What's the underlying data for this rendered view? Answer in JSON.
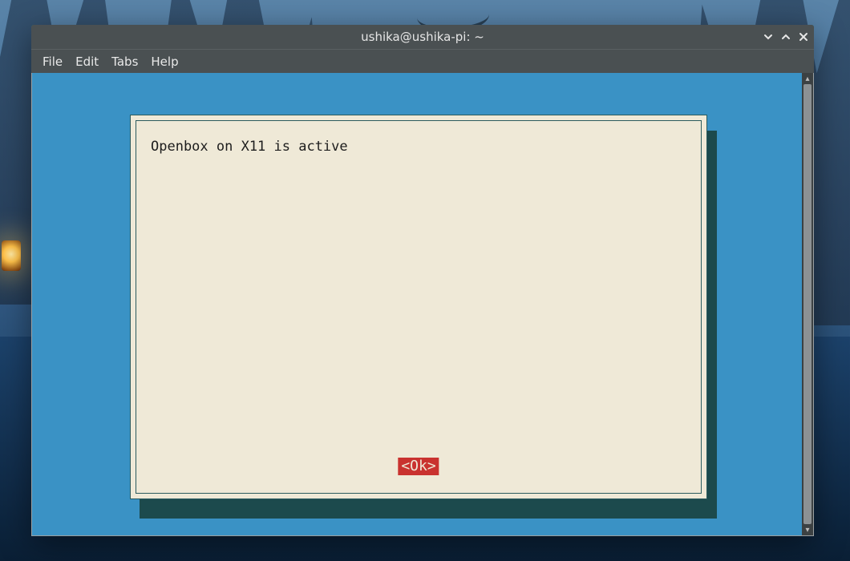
{
  "window": {
    "title": "ushika@ushika-pi: ~"
  },
  "menubar": {
    "items": [
      "File",
      "Edit",
      "Tabs",
      "Help"
    ]
  },
  "dialog": {
    "message": "Openbox on X11 is active",
    "ok_label": "<Ok>"
  },
  "colors": {
    "terminal_bg": "#3a92c5",
    "dialog_bg": "#efe9d7",
    "dialog_shadow": "#1c4a4d",
    "button_bg": "#c9322f",
    "titlebar_bg": "#4a5052"
  }
}
